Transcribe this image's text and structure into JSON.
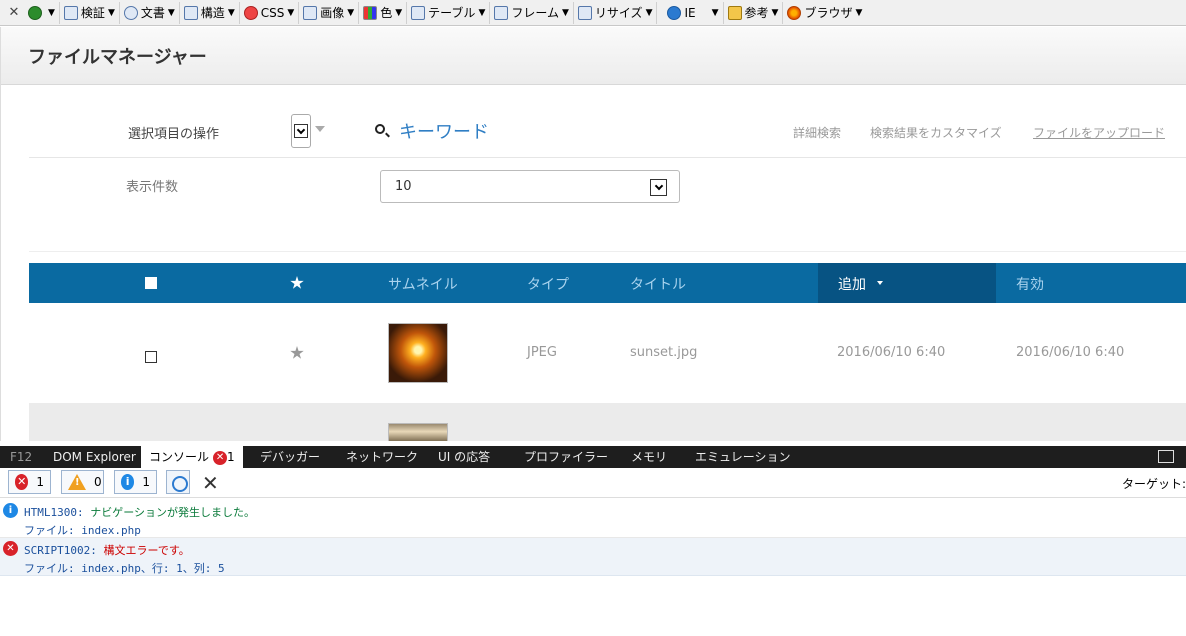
{
  "toolbar": {
    "items": [
      {
        "label": "検証",
        "icon": "html-icon"
      },
      {
        "label": "文書",
        "icon": "info-icon"
      },
      {
        "label": "構造",
        "icon": "table-icon"
      },
      {
        "label": "CSS",
        "icon": "css-icon"
      },
      {
        "label": "画像",
        "icon": "image-icon"
      },
      {
        "label": "色",
        "icon": "palette-icon"
      },
      {
        "label": "テーブル",
        "icon": "grid-icon"
      },
      {
        "label": "フレーム",
        "icon": "frame-icon"
      },
      {
        "label": "リサイズ",
        "icon": "resize-icon"
      },
      {
        "label": "IE",
        "icon": "ie-icon"
      },
      {
        "label": "参考",
        "icon": "pencil-icon"
      },
      {
        "label": "ブラウザ",
        "icon": "firefox-icon"
      }
    ]
  },
  "page": {
    "title": "ファイルマネージャー",
    "selected_ops_label": "選択項目の操作",
    "keyword": "キーワード",
    "links": {
      "advanced_search": "詳細検索",
      "customize": "検索結果をカスタマイズ",
      "upload": "ファイルをアップロード"
    },
    "display_count_label": "表示件数",
    "display_count_value": "10"
  },
  "table": {
    "headers": {
      "thumbnail": "サムネイル",
      "type": "タイプ",
      "title": "タイトル",
      "added": "追加",
      "valid": "有効"
    },
    "rows": [
      {
        "type": "JPEG",
        "title": "sunset.jpg",
        "added": "2016/06/10 6:40",
        "valid": "2016/06/10 6:40"
      }
    ]
  },
  "devtools": {
    "tabs": {
      "f12": "F12",
      "dom": "DOM Explorer",
      "console": "コンソール",
      "console_errors": "1",
      "debugger": "デバッガー",
      "network": "ネットワーク",
      "ui": "UI の応答",
      "profiler": "プロファイラー",
      "memory": "メモリ",
      "emulation": "エミュレーション"
    },
    "filters": {
      "errors": "1",
      "warnings": "0",
      "info": "1"
    },
    "target_label": "ターゲット:",
    "messages": [
      {
        "code": "HTML1300:",
        "text": " ナビゲーションが発生しました。",
        "detail": "ファイル: index.php"
      },
      {
        "code": "SCRIPT1002:",
        "text": " 構文エラーです。",
        "detail": "ファイル: index.php、行: 1、列: 5"
      }
    ]
  },
  "colors": {
    "header_blue": "#0a6aa1",
    "sorted_col": "#075383",
    "link_blue": "#2f7ec4",
    "error_red": "#d8222a",
    "info_blue": "#1e88e5"
  }
}
